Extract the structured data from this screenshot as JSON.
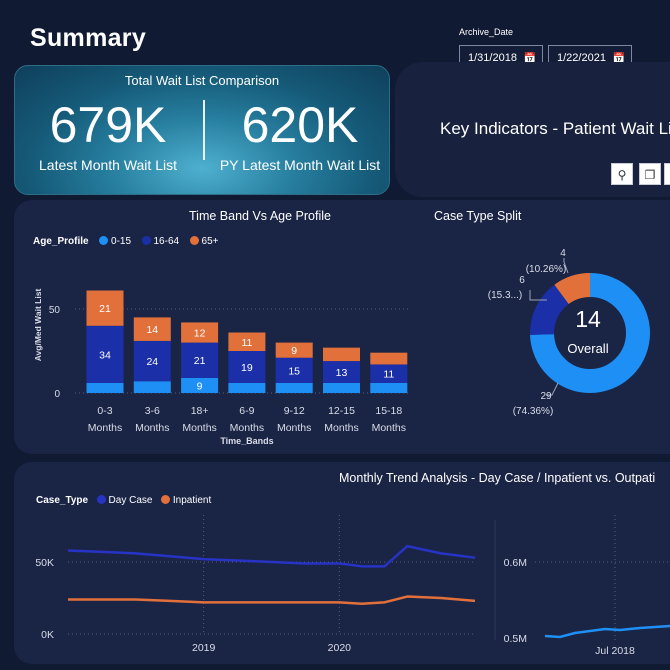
{
  "page": {
    "title": "Summary"
  },
  "kpi": {
    "heading": "Total Wait List Comparison",
    "latest_value": "679K",
    "latest_label": "Latest Month Wait List",
    "py_value": "620K",
    "py_label": "PY Latest Month Wait List"
  },
  "filter": {
    "label": "Archive_Date",
    "start_date": "1/31/2018",
    "end_date": "1/22/2021",
    "calendar_icon": "calendar-icon"
  },
  "key_indicators": {
    "title": "Key Indicators - Patient Wait Lis",
    "toolbar": {
      "pin_icon": "pin-icon",
      "copy_icon": "copy-icon"
    }
  },
  "colors": {
    "age_0_15": "#1e90f5",
    "age_16_64": "#1a2fa8",
    "age_65_plus": "#e2703a",
    "day_case": "#2733c4",
    "inpatient": "#e2703a",
    "panel": "#1a2546",
    "background": "#111a33"
  },
  "band_chart": {
    "title": "Time Band Vs Age Profile",
    "legend_title": "Age_Profile",
    "legend": [
      "0-15",
      "16-64",
      "65+"
    ],
    "ylabel": "Avg/Med Wait List",
    "xlabel": "Time_Bands",
    "y_ticks": [
      "0",
      "50"
    ]
  },
  "donut_chart": {
    "title": "Case Type Split",
    "center_value": "14",
    "center_label": "Overall",
    "labels": [
      {
        "value": "29",
        "pct": "(74.36%)"
      },
      {
        "value": "6",
        "pct": "(15.3...)"
      },
      {
        "value": "4",
        "pct": "(10.26%)"
      }
    ]
  },
  "trend_chart": {
    "title": "Monthly Trend Analysis - Day Case / Inpatient vs. Outpati",
    "legend_title": "Case_Type",
    "legend": [
      "Day Case",
      "Inpatient"
    ],
    "y_ticks": [
      "0K",
      "50K"
    ],
    "x_ticks": [
      "2019",
      "2020"
    ],
    "right_y_ticks": [
      "0.6M",
      "0.5M"
    ],
    "right_x_tick": "Jul 2018"
  },
  "chart_data": [
    {
      "type": "bar",
      "stacked": true,
      "title": "Time Band Vs Age Profile",
      "xlabel": "Time_Bands",
      "ylabel": "Avg/Med Wait List",
      "categories": [
        "0-3 Months",
        "3-6 Months",
        "18+ Months",
        "6-9 Months",
        "9-12 Months",
        "12-15 Months",
        "15-18 Months"
      ],
      "series": [
        {
          "name": "0-15",
          "values": [
            6,
            7,
            9,
            6,
            6,
            6,
            6
          ]
        },
        {
          "name": "16-64",
          "values": [
            34,
            24,
            21,
            19,
            15,
            13,
            11
          ]
        },
        {
          "name": "65+",
          "values": [
            21,
            14,
            12,
            11,
            9,
            8,
            7
          ]
        }
      ],
      "data_labels": [
        [
          "",
          "",
          "9",
          "",
          "",
          "",
          ""
        ],
        [
          "34",
          "24",
          "21",
          "19",
          "15",
          "13",
          "11"
        ],
        [
          "21",
          "14",
          "12",
          "11",
          "9",
          "",
          ""
        ]
      ],
      "ylim": [
        0,
        70
      ],
      "grid": true,
      "legend_position": "top-left"
    },
    {
      "type": "pie",
      "donut": true,
      "title": "Case Type Split",
      "slices": [
        {
          "value": 29,
          "percent": 74.36
        },
        {
          "value": 6,
          "percent": 15.38
        },
        {
          "value": 4,
          "percent": 10.26
        }
      ]
    },
    {
      "type": "line",
      "title": "Monthly Trend Analysis - Day Case / Inpatient vs. Outpati",
      "x": [
        "2018-01",
        "2018-04",
        "2018-07",
        "2018-10",
        "2019-01",
        "2019-04",
        "2019-07",
        "2019-10",
        "2020-01",
        "2020-03",
        "2020-05",
        "2020-07",
        "2020-10",
        "2021-01"
      ],
      "series": [
        {
          "name": "Day Case",
          "values": [
            58,
            57,
            56,
            54,
            52,
            51,
            50,
            49,
            49,
            47,
            47,
            61,
            56,
            53
          ]
        },
        {
          "name": "Inpatient",
          "values": [
            24,
            24,
            24,
            23,
            22,
            22,
            22,
            22,
            22,
            21,
            22,
            26,
            25,
            23
          ]
        }
      ],
      "ylim": [
        0,
        70
      ],
      "grid": true,
      "legend_position": "top-left"
    }
  ]
}
